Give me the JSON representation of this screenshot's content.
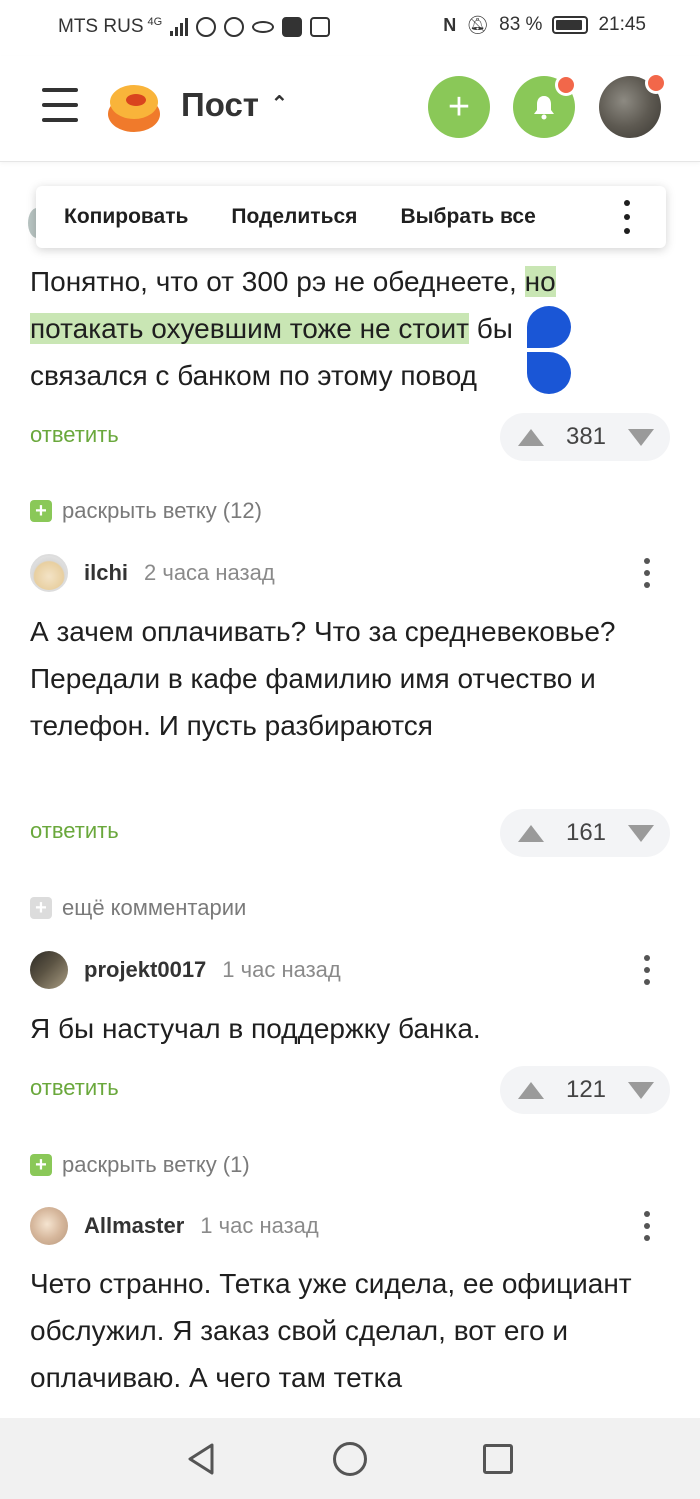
{
  "status_bar": {
    "carrier": "MTS RUS",
    "network": "4G",
    "battery": "83 %",
    "time": "21:45"
  },
  "header": {
    "title": "Пост",
    "plus_label": "+",
    "icons": [
      "menu-icon",
      "logo",
      "chevron-up-icon",
      "plus-icon",
      "bell-icon",
      "avatar"
    ]
  },
  "context_menu": {
    "copy": "Копировать",
    "share": "Поделиться",
    "select_all": "Выбрать все"
  },
  "comments": [
    {
      "text_plain_1": "Понятно, что от 300 рэ не обеднеете, ",
      "text_sel_1": "но",
      "text_sel_2": "потакать охуевшим тоже не стоит",
      "text_plain_2": " бы",
      "text_plain_3": "связался с банком по этому повод",
      "reply": "ответить",
      "votes": "381"
    },
    {
      "author": "ilchi",
      "time": "2 часа назад",
      "text": "А зачем оплачивать? Что за средневековье? Передали в кафе фамилию имя отчество и телефон. И пусть разбираются",
      "reply": "ответить",
      "votes": "161"
    },
    {
      "author": "projekt0017",
      "time": "1 час назад",
      "text": "Я бы настучал в поддержку банка.",
      "reply": "ответить",
      "votes": "121"
    },
    {
      "author": "Allmaster",
      "time": "1 час назад",
      "text": "Чето странно. Тетка уже сидела, ее официант обслужил. Я заказ свой сделал, вот его и оплачиваю. А чего там тетка"
    }
  ],
  "expanders": {
    "branch_12": "раскрыть ветку (12)",
    "more_comments": "ещё комментарии",
    "branch_1": "раскрыть ветку (1)"
  },
  "colors": {
    "accent_green": "#8ac858",
    "reply_green": "#6aa83c",
    "selection": "#c9e6b4",
    "handle_blue": "#1a56d6",
    "notif_red": "#f2674a"
  }
}
